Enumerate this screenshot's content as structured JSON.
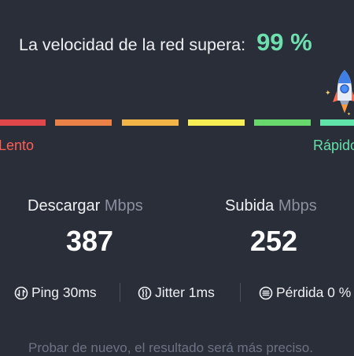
{
  "headline": {
    "text": "La velocidad de la red supera:",
    "percent": "99 %"
  },
  "scale": {
    "slow_label": "Lento",
    "fast_label": "Rápido",
    "segment_colors": [
      "#e0474a",
      "#ea8146",
      "#f2b447",
      "#f7ee54",
      "#69d86c",
      "#5fe3a8"
    ]
  },
  "download": {
    "label": "Descargar",
    "unit": "Mbps",
    "value": "387"
  },
  "upload": {
    "label": "Subida",
    "unit": "Mbps",
    "value": "252"
  },
  "metrics": [
    {
      "icon": "ping-icon",
      "text": "Ping 30ms"
    },
    {
      "icon": "jitter-icon",
      "text": "Jitter 1ms"
    },
    {
      "icon": "packet-loss-icon",
      "text": "Pérdida 0 %"
    }
  ],
  "footer": {
    "text": "Probar de nuevo, el resultado será más preciso."
  },
  "colors": {
    "accent": "#6ee0b0",
    "background": "#2a2e39"
  }
}
